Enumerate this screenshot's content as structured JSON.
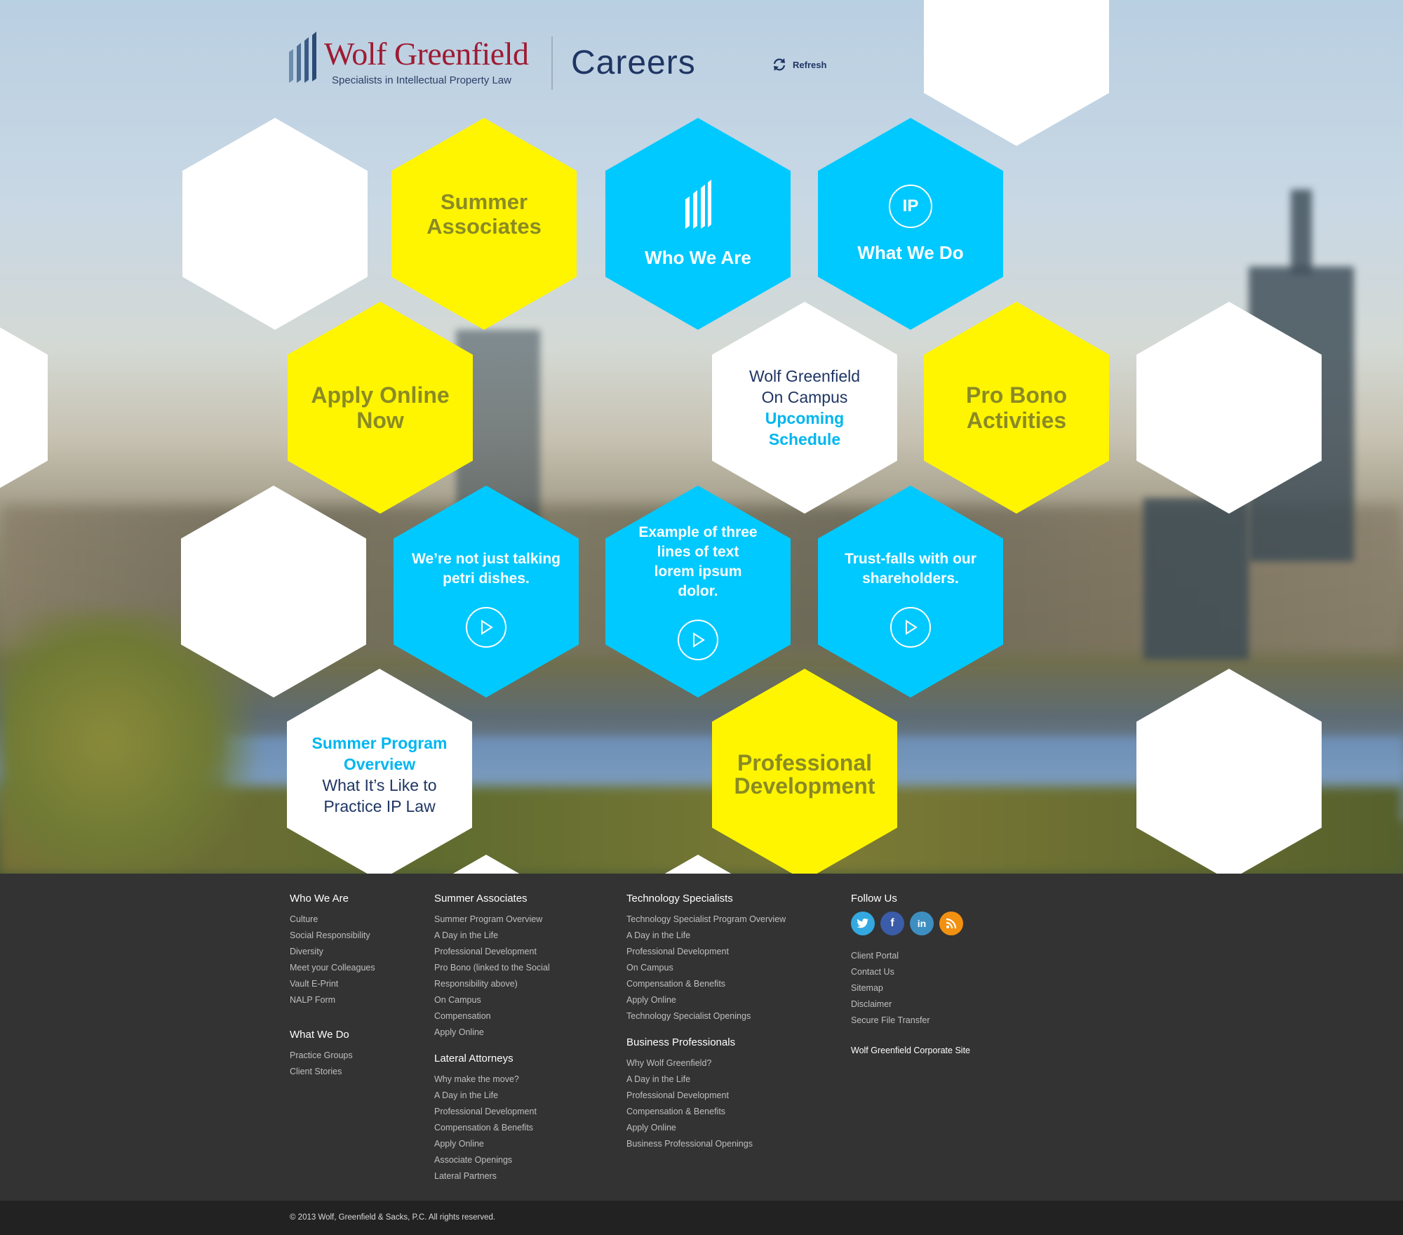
{
  "header": {
    "logo_name": "Wolf Greenfield",
    "logo_tagline": "Specialists in Intellectual Property Law",
    "section_title": "Careers",
    "refresh_label": "Refresh"
  },
  "tiles": {
    "summer_associates": "Summer Associates",
    "who_we_are": "Who We Are",
    "what_we_do": "What We Do",
    "ip_badge": "IP",
    "apply_online": "Apply Online Now",
    "on_campus_line1": "Wolf Greenfield",
    "on_campus_line2": "On Campus",
    "on_campus_link": "Upcoming Schedule",
    "pro_bono": "Pro Bono Activities",
    "video1": "We’re not just talking petri dishes.",
    "video2": "Example of three lines of text lorem ipsum dolor.",
    "video3": "Trust-falls with our shareholders.",
    "summer_program_link": "Summer Program Overview",
    "summer_program_text": "What It’s Like to Practice IP Law",
    "professional_development": "Professional Development"
  },
  "footer": {
    "col1": {
      "head1": "Who We Are",
      "links1": [
        "Culture",
        "Social Responsibility",
        "Diversity",
        "Meet your Colleagues",
        "Vault E-Print",
        "NALP Form"
      ],
      "head2": "What We Do",
      "links2": [
        "Practice Groups",
        "Client Stories"
      ]
    },
    "col2": {
      "head1": "Summer Associates",
      "links1": [
        "Summer Program Overview",
        "A Day in the Life",
        "Professional Development",
        "Pro Bono (linked to the Social",
        "Responsibility above)",
        "On Campus",
        "Compensation",
        "Apply Online"
      ],
      "head2": "Lateral Attorneys",
      "links2": [
        "Why make the move?",
        "A Day in the Life",
        "Professional Development",
        "Compensation & Benefits",
        "Apply Online",
        "Associate Openings",
        "Lateral Partners"
      ]
    },
    "col3": {
      "head1": "Technology Specialists",
      "links1": [
        "Technology Specialist Program Overview",
        "A Day in the Life",
        "Professional Development",
        "On Campus",
        "Compensation & Benefits",
        "Apply Online",
        "Technology Specialist Openings"
      ],
      "head2": "Business Professionals",
      "links2": [
        "Why Wolf Greenfield?",
        "A Day in the Life",
        "Professional Development",
        "Compensation & Benefits",
        "Apply Online",
        "Business Professional Openings"
      ]
    },
    "col4": {
      "head": "Follow Us",
      "links": [
        "Client Portal",
        "Contact Us",
        "Sitemap",
        "Disclaimer",
        "Secure File Transfer"
      ],
      "corporate": "Wolf Greenfield Corporate Site"
    },
    "copyright": "© 2013 Wolf, Greenfield & Sacks, P.C. All rights reserved."
  },
  "colors": {
    "yellow": "#fff500",
    "blue": "#00c9ff",
    "navy": "#1f3563",
    "brand_red": "#9e1b32",
    "twitter": "#34a8e0",
    "facebook": "#3b5ca8",
    "linkedin": "#3d8fc2",
    "rss": "#f29111"
  },
  "icons": [
    "twitter-icon",
    "facebook-icon",
    "linkedin-icon",
    "rss-icon",
    "refresh-icon",
    "play-icon",
    "bars-logo-icon"
  ]
}
